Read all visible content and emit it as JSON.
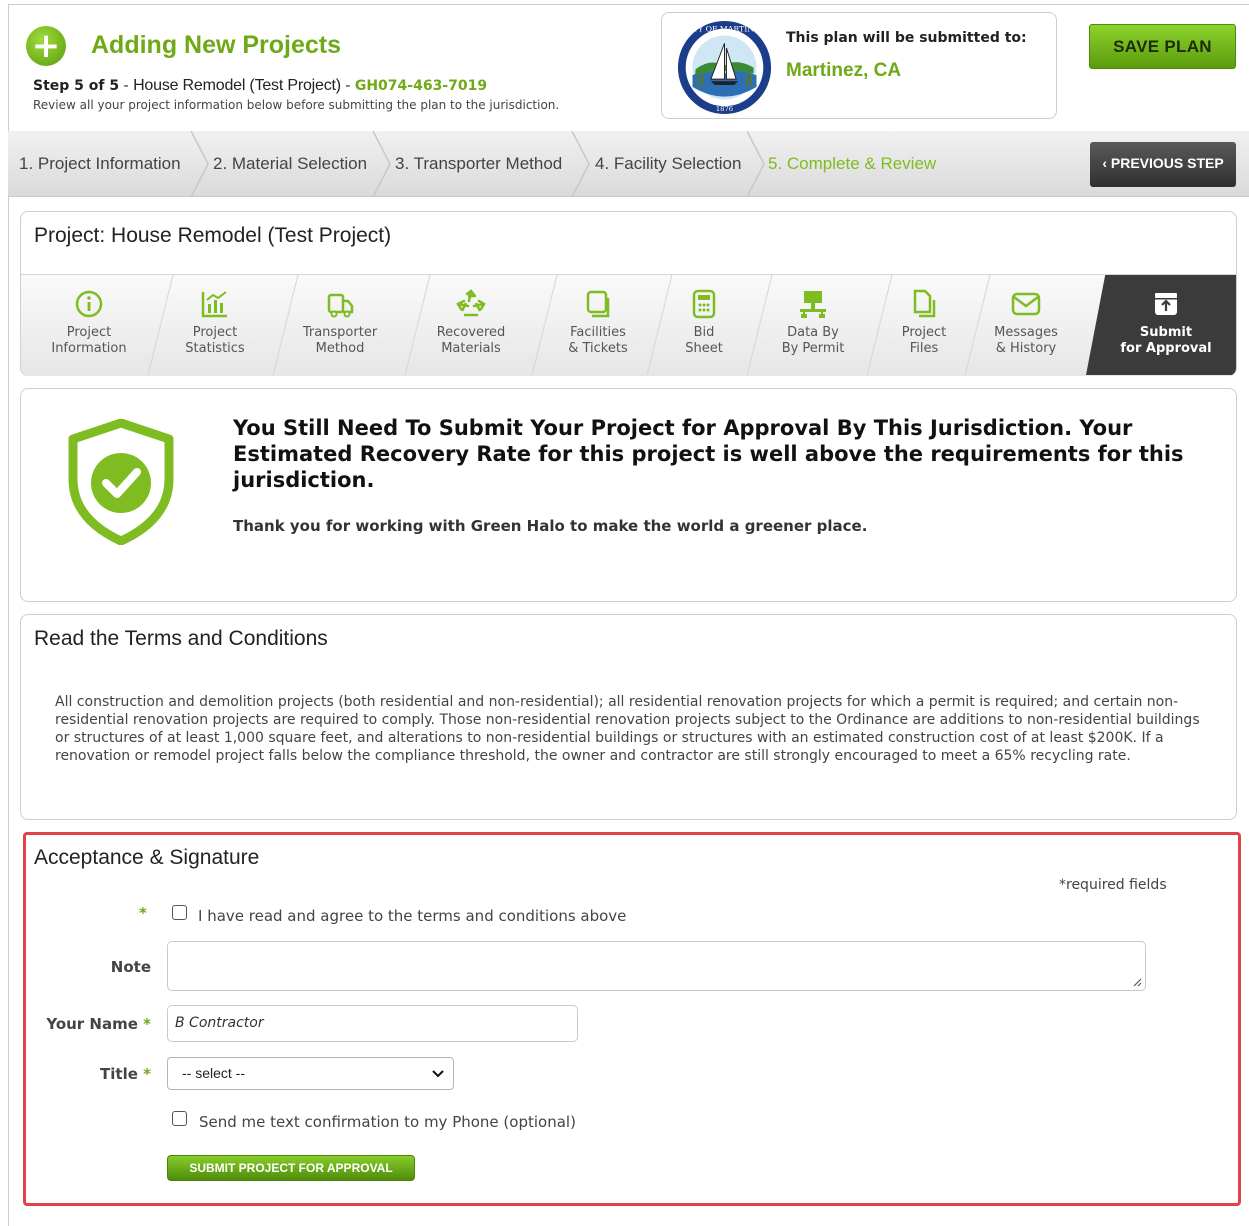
{
  "header": {
    "title": "Adding New Projects",
    "step_prefix": "Step 5 of 5",
    "dash": " - ",
    "project_name": "House Remodel (Test Project)",
    "project_code": "GH074-463-7019",
    "subtitle": "Review all your project information below before submitting the plan to the jurisdiction.",
    "submitted_label": "This plan will be submitted to:",
    "jurisdiction": "Martinez, CA",
    "seal_text_top": "CITY OF MARTINEZ",
    "seal_text_bottom": "1876",
    "save_button": "SAVE PLAN",
    "plus_icon": "plus-circle-icon"
  },
  "steps": [
    {
      "label": "1. Project Information"
    },
    {
      "label": "2. Material Selection"
    },
    {
      "label": "3. Transporter Method"
    },
    {
      "label": "4. Facility Selection"
    },
    {
      "label": "5. Complete & Review"
    }
  ],
  "prev_button": "‹  PREVIOUS STEP",
  "project_panel": {
    "title": "Project:  House Remodel (Test Project)",
    "tabs": [
      {
        "line1": "Project",
        "line2": "Information",
        "icon": "info-icon"
      },
      {
        "line1": "Project",
        "line2": "Statistics",
        "icon": "chart-icon"
      },
      {
        "line1": "Transporter",
        "line2": "Method",
        "icon": "truck-icon"
      },
      {
        "line1": "Recovered",
        "line2": "Materials",
        "icon": "recycle-icon"
      },
      {
        "line1": "Facilities",
        "line2": "& Tickets",
        "icon": "facility-icon"
      },
      {
        "line1": "Bid",
        "line2": "Sheet",
        "icon": "calculator-icon"
      },
      {
        "line1": "Data By",
        "line2": "By Permit",
        "icon": "network-icon"
      },
      {
        "line1": "Project",
        "line2": "Files",
        "icon": "files-icon"
      },
      {
        "line1": "Messages",
        "line2": "& History",
        "icon": "envelope-icon"
      },
      {
        "line1": "Submit",
        "line2": "for Approval",
        "icon": "upload-box-icon"
      }
    ]
  },
  "message": {
    "heading": "You Still Need To Submit Your Project for Approval By This Jurisdiction. Your Estimated Recovery Rate for this project is well above the requirements for this jurisdiction.",
    "thanks": "Thank you for working with Green Halo to make the world a greener place."
  },
  "terms": {
    "title": "Read the Terms and Conditions",
    "body": "All construction and demolition projects (both residential and non-residential); all residential renovation projects for which a permit is required; and certain non-residential renovation projects are required to comply. Those non-residential renovation projects subject to the Ordinance are additions to non-residential buildings or structures of at least 1,000 square feet, and alterations to non-residential buildings or structures with an estimated construction cost of at least $200K. If a renovation or remodel project falls below the compliance threshold, the owner and contractor are still strongly encouraged to meet a 65% recycling rate."
  },
  "signature": {
    "title": "Acceptance & Signature",
    "required_note": "*required fields",
    "asterisk": "*",
    "agree_label": "I have read and agree to the terms and conditions above",
    "note_label": "Note",
    "note_value": "",
    "name_label": "Your Name",
    "name_value": "B Contractor",
    "title_label": "Title",
    "title_value": "-- select --",
    "sms_label": "Send me text confirmation to my Phone (optional)",
    "submit_button": "SUBMIT PROJECT FOR APPROVAL"
  },
  "colors": {
    "brand_green": "#6fa915",
    "active_tab": "#3b3b3b",
    "highlight_border": "#e0424b"
  }
}
